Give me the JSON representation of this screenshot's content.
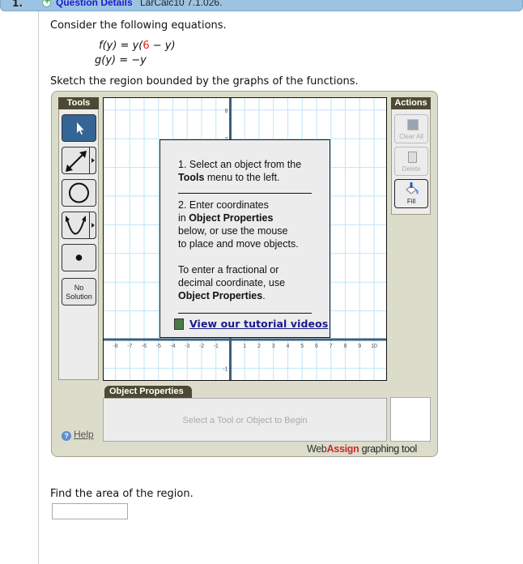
{
  "header": {
    "number": "1.",
    "question_details_label": "Question Details",
    "question_code": "LarCalc10 7.1.026."
  },
  "problem": {
    "intro": "Consider the following equations.",
    "eq1": {
      "lhs": "f(y)",
      "eq": " = ",
      "pre": "y(",
      "red": "6",
      "post": " − y)"
    },
    "eq2": {
      "lhs": "g(y)",
      "eq": " = ",
      "rhs": "−y"
    },
    "instruction": "Sketch the region bounded by the graphs of the functions."
  },
  "tools": {
    "title": "Tools",
    "items": [
      {
        "name": "select",
        "icon": "pointer-arrow-icon",
        "selected": true
      },
      {
        "name": "line",
        "icon": "double-arrow-line-icon",
        "has_menu": true
      },
      {
        "name": "circle",
        "icon": "circle-icon"
      },
      {
        "name": "parabola",
        "icon": "parabola-icon",
        "has_menu": true
      },
      {
        "name": "point",
        "icon": "point-icon"
      },
      {
        "name": "no-solution",
        "label_line1": "No",
        "label_line2": "Solution"
      }
    ]
  },
  "actions": {
    "title": "Actions",
    "items": [
      {
        "label": "Clear All",
        "icon": "clear-all-icon",
        "enabled": false
      },
      {
        "label": "Delete",
        "icon": "trash-icon",
        "enabled": false
      },
      {
        "label": "Fill",
        "icon": "paint-bucket-icon",
        "enabled": true
      }
    ]
  },
  "graph": {
    "x_min": -8,
    "x_max": 10,
    "y_min": -1,
    "y_max": 8,
    "x_tick_labels": [
      "-8",
      "-7",
      "-6",
      "-5",
      "-4",
      "-3",
      "-2",
      "-1",
      "1",
      "2",
      "3",
      "4",
      "5",
      "6",
      "7",
      "8",
      "9",
      "10"
    ],
    "y_tick_labels": [
      "8",
      "7",
      "-1"
    ],
    "grid_color": "#bfe6f5",
    "axis_color": "#3a5f80"
  },
  "popup": {
    "step1_line1": "1. Select an object from the",
    "step1_bold": "Tools",
    "step1_rest": " menu to the left.",
    "step2_line1": "2. Enter coordinates",
    "step2_pre": "in ",
    "step2_bold": "Object Properties",
    "step2_line3": "below, or use the mouse",
    "step2_line4": "to place and move objects.",
    "note_line1": "To enter a fractional or",
    "note_line2": "decimal coordinate, use",
    "note_bold": "Object Properties",
    "note_end": ".",
    "tutorial_link": "View our tutorial videos"
  },
  "object_properties": {
    "tab_label": "Object Properties",
    "placeholder": "Select a Tool or Object to Begin"
  },
  "help_label": "Help",
  "branding": {
    "web": "Web",
    "assign": "Assign",
    "rest": " graphing tool"
  },
  "question2": {
    "text": "Find the area of the region.",
    "answer_value": ""
  }
}
